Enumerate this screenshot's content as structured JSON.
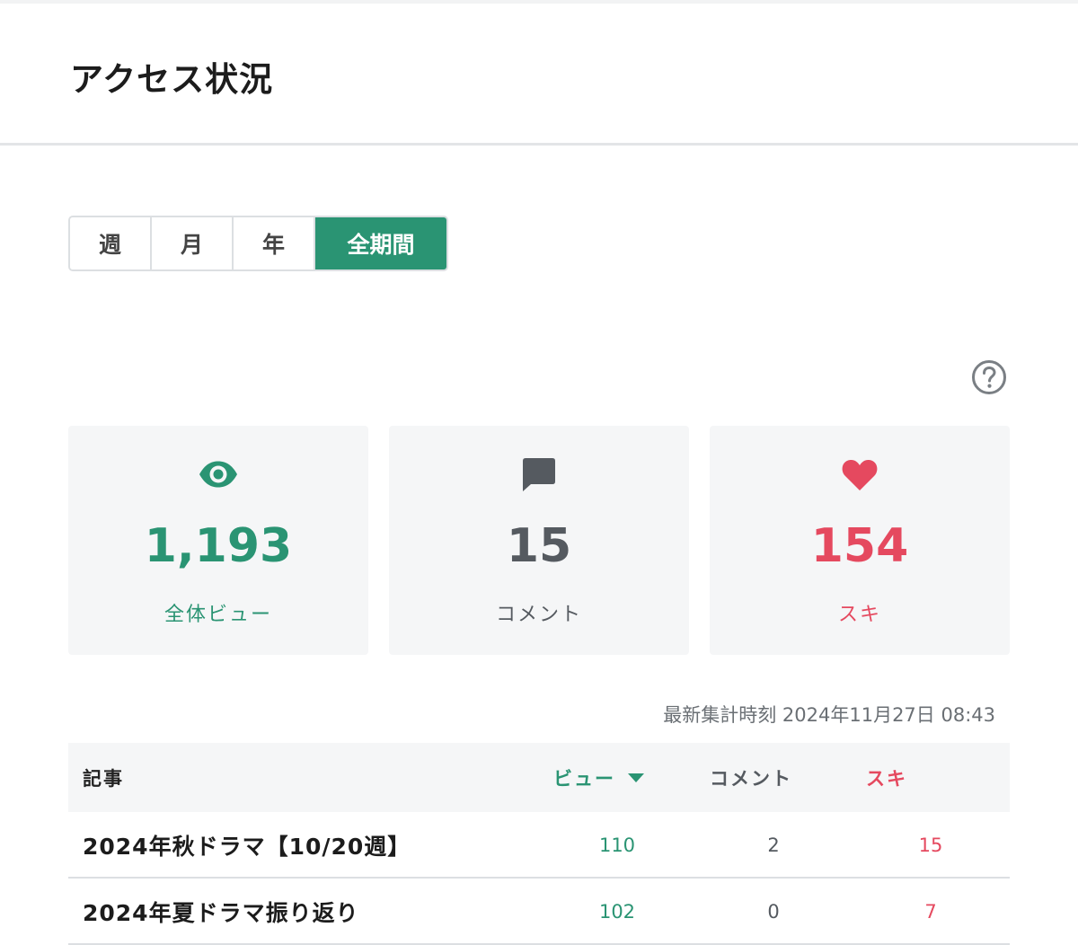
{
  "header": {
    "title": "アクセス状況"
  },
  "period_tabs": [
    {
      "label": "週",
      "active": false
    },
    {
      "label": "月",
      "active": false
    },
    {
      "label": "年",
      "active": false
    },
    {
      "label": "全期間",
      "active": true
    }
  ],
  "stats": {
    "views": {
      "value": "1,193",
      "label": "全体ビュー",
      "icon": "eye-icon",
      "color": "#2a9473"
    },
    "comments": {
      "value": "15",
      "label": "コメント",
      "icon": "comment-icon",
      "color": "#555a60"
    },
    "likes": {
      "value": "154",
      "label": "スキ",
      "icon": "heart-icon",
      "color": "#e5495f"
    }
  },
  "updated_at": "最新集計時刻 2024年11月27日 08:43",
  "table": {
    "headers": {
      "article": "記事",
      "views": "ビュー",
      "comments": "コメント",
      "likes": "スキ"
    },
    "sort": {
      "column": "views",
      "direction": "desc"
    },
    "rows": [
      {
        "title": "2024年秋ドラマ【10/20週】",
        "views": "110",
        "comments": "2",
        "likes": "15"
      },
      {
        "title": "2024年夏ドラマ振り返り",
        "views": "102",
        "comments": "0",
        "likes": "7"
      }
    ]
  },
  "colors": {
    "accent": "#2a9473",
    "like": "#e5495f",
    "neutral": "#555a60"
  }
}
